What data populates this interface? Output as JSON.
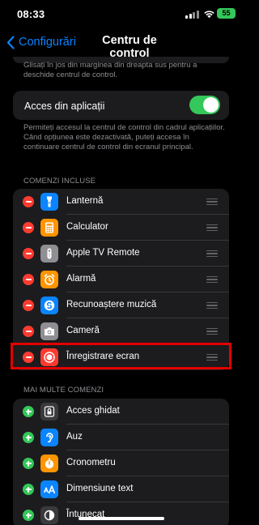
{
  "status_bar": {
    "time": "08:33",
    "battery": "55"
  },
  "nav": {
    "back_label": "Configurări",
    "title": "Centru de control"
  },
  "intro_note": "Glisați în jos din marginea din dreapta sus pentru a deschide centrul de control.",
  "access_toggle": {
    "label": "Acces din aplicații",
    "on": true
  },
  "access_note": "Permiteți accesul la centrul de control din cadrul aplicațiilor. Când opțiunea este dezactivată, puteți accesa în continuare centrul de control din ecranul principal.",
  "included": {
    "header": "COMENZI INCLUSE",
    "items": [
      {
        "label": "Lanternă",
        "icon": "flashlight-icon",
        "color": "#0a84ff"
      },
      {
        "label": "Calculator",
        "icon": "calculator-icon",
        "color": "#ff9500"
      },
      {
        "label": "Apple TV Remote",
        "icon": "remote-icon",
        "color": "#8e8e93"
      },
      {
        "label": "Alarmă",
        "icon": "alarm-icon",
        "color": "#ff9500"
      },
      {
        "label": "Recunoaștere muzică",
        "icon": "shazam-icon",
        "color": "#0a84ff"
      },
      {
        "label": "Cameră",
        "icon": "camera-icon",
        "color": "#8e8e93"
      },
      {
        "label": "Înregistrare ecran",
        "icon": "screen-record-icon",
        "color": "#ff3b30"
      }
    ]
  },
  "more": {
    "header": "MAI MULTE COMENZI",
    "items": [
      {
        "label": "Acces ghidat",
        "icon": "lock-icon",
        "color": "#3a3a3c"
      },
      {
        "label": "Auz",
        "icon": "ear-icon",
        "color": "#0a84ff"
      },
      {
        "label": "Cronometru",
        "icon": "timer-icon",
        "color": "#ff9500"
      },
      {
        "label": "Dimensiune text",
        "icon": "text-size-icon",
        "color": "#0a84ff"
      },
      {
        "label": "Întunecat",
        "icon": "dark-mode-icon",
        "color": "#3a3a3c"
      }
    ]
  },
  "colors": {
    "accent": "#0a84ff",
    "toggle_on": "#34c759",
    "highlight": "#e30000"
  }
}
